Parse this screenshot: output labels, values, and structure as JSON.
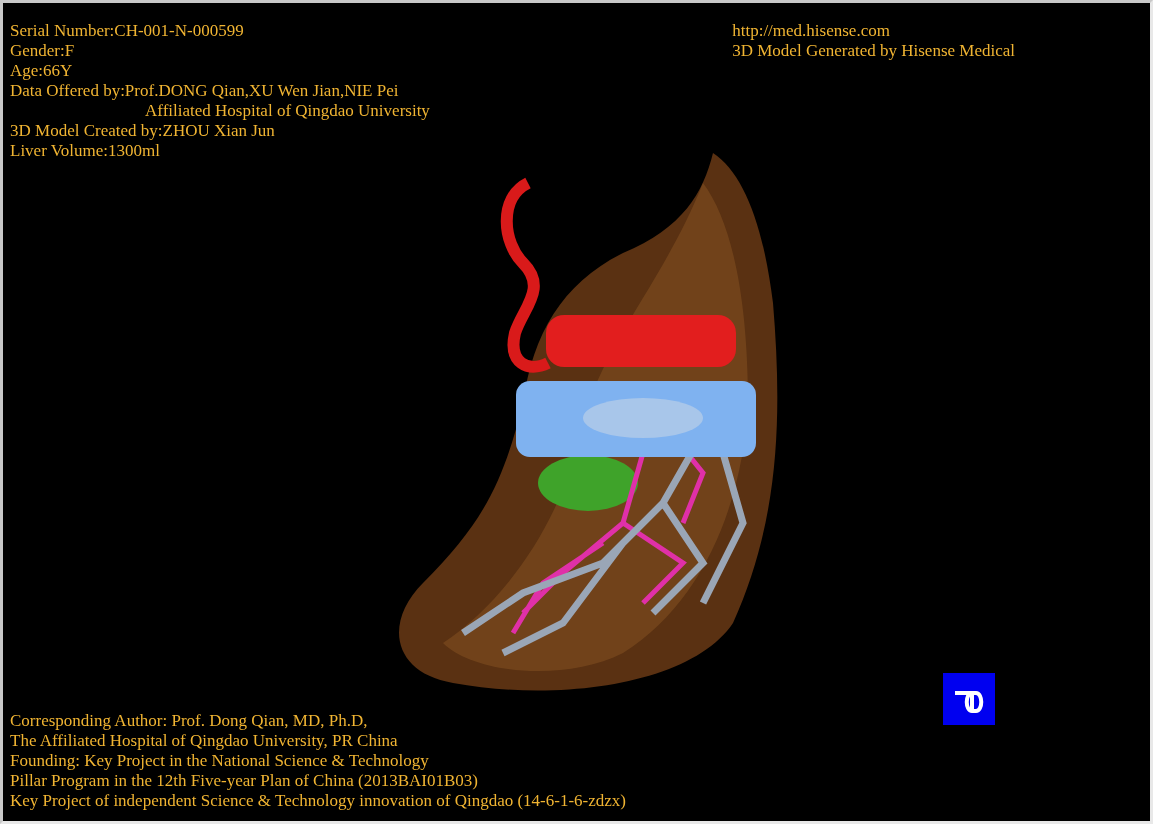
{
  "header_info": [
    {
      "text": "Serial Number:CH-001-N-000599",
      "kind": "plain"
    },
    {
      "text": "Gender:F",
      "kind": "plain"
    },
    {
      "text": "Age:66Y",
      "kind": "plain"
    },
    {
      "text": "Data Offered by:Prof.DONG Qian,XU Wen Jian,NIE Pei",
      "kind": "plain"
    },
    {
      "text": "Affiliated Hospital of Qingdao University",
      "kind": "indented"
    },
    {
      "text": "3D Model Created by:ZHOU Xian Jun",
      "kind": "plain"
    },
    {
      "text": "Liver Volume:1300ml",
      "kind": "plain"
    }
  ],
  "vendor_info": [
    "http://med.hisense.com",
    "3D Model Generated by Hisense Medical"
  ],
  "footer_info": [
    "Corresponding Author: Prof. Dong Qian, MD, Ph.D,",
    "The Affiliated Hospital of Qingdao University, PR China",
    "Founding: Key Project in the National Science & Technology",
    "Pillar Program in the 12th Five-year Plan of China (2013BAI01B03)",
    "Key Project of independent Science & Technology innovation of Qingdao (14-6-1-6-zdzx)"
  ]
}
